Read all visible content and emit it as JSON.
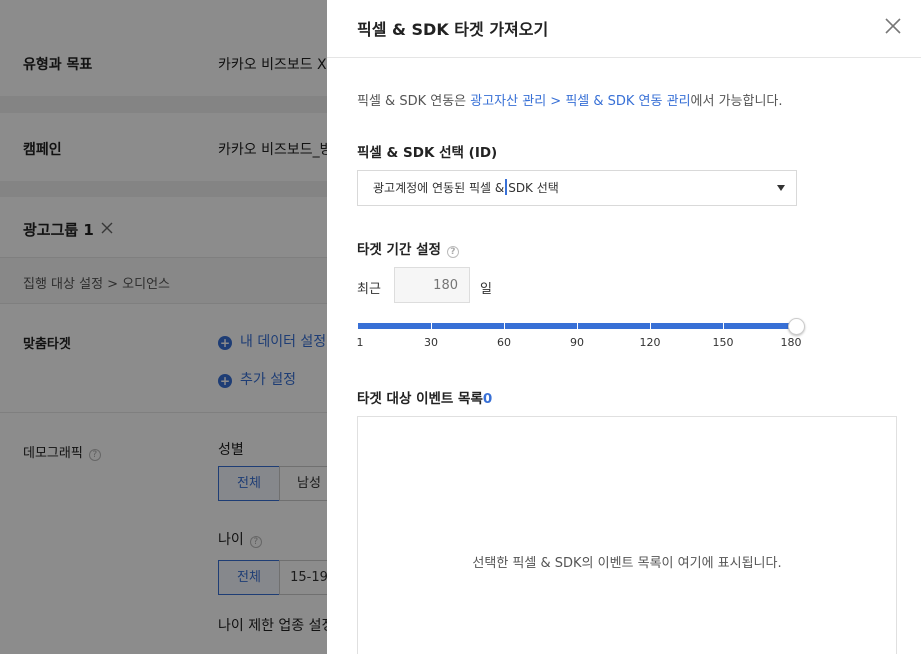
{
  "background": {
    "type_goal": {
      "label": "유형과 목표",
      "value": "카카오 비즈보드 X"
    },
    "campaign": {
      "label": "캠페인",
      "value": "카카오 비즈보드_방"
    },
    "ad_group": {
      "title": "광고그룹 1",
      "close_icon": "close-icon"
    },
    "breadcrumb": "집행 대상 설정 > 오디언스",
    "custom_target": {
      "label": "맞춤타겟",
      "my_data": "내 데이터 설정",
      "add": "추가 설정"
    },
    "demographics": {
      "label": "데모그래픽",
      "gender": {
        "label": "성별",
        "options": [
          "전체",
          "남성"
        ]
      },
      "age": {
        "label": "나이",
        "options": [
          "전체",
          "15-19"
        ]
      },
      "age_restriction": "나이 제한 업종 설정"
    }
  },
  "drawer": {
    "title": "픽셀 & SDK 타겟 가져오기",
    "info": {
      "prefix": "픽셀 & SDK 연동은 ",
      "link": "광고자산 관리 > 픽셀 & SDK 연동 관리",
      "suffix": "에서 가능합니다."
    },
    "pixel_select": {
      "label": "픽셀 & SDK 선택 (ID)",
      "placeholder_before": "광고계정에 연동된 픽셀 &",
      "placeholder_after": "SDK 선택"
    },
    "period": {
      "label": "타겟 기간 설정",
      "recent_label": "최근",
      "days_placeholder": "180",
      "unit": "일",
      "slider_value": 180,
      "ticks": [
        "1",
        "30",
        "60",
        "90",
        "120",
        "150",
        "180"
      ]
    },
    "events": {
      "label": "타겟 대상 이벤트 목록",
      "count": "0",
      "empty_text": "선택한 픽셀 & SDK의 이벤트 목록이 여기에 표시됩니다."
    }
  },
  "colors": {
    "accent": "#3870d6",
    "overlay": "rgba(0,0,0,0.45)"
  }
}
